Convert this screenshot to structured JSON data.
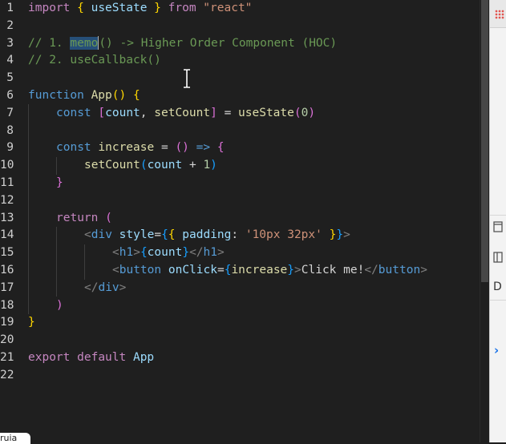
{
  "editor": {
    "line_numbers": [
      "1",
      "2",
      "3",
      "4",
      "5",
      "6",
      "7",
      "8",
      "9",
      "10",
      "11",
      "12",
      "13",
      "14",
      "15",
      "16",
      "17",
      "18",
      "19",
      "20",
      "21",
      "22"
    ],
    "tokens": {
      "l1": {
        "import": "import",
        "lb": "{",
        "useState": "useState",
        "rb": "}",
        "from": "from",
        "str": "\"react\""
      },
      "l3": {
        "c1": "// 1. ",
        "memo": "memo",
        "c2": "() -> Higher Order Component (HOC)"
      },
      "l4": {
        "c": "// 2. useCallback()"
      },
      "l6": {
        "function": "function",
        "name": "App",
        "lp": "(",
        "rp": ")",
        "lb": "{"
      },
      "l7": {
        "const": "const",
        "lb": "[",
        "count": "count",
        "comma": ",",
        "setCount": "setCount",
        "rb": "]",
        "eq": "=",
        "useState": "useState",
        "lp": "(",
        "zero": "0",
        "rp": ")"
      },
      "l9": {
        "const": "const",
        "increase": "increase",
        "eq": "=",
        "lp": "(",
        "rp": ")",
        "arrow": "=>",
        "lb": "{"
      },
      "l10": {
        "setCount": "setCount",
        "lp": "(",
        "count": "count",
        "plus": "+",
        "one": "1",
        "rp": ")"
      },
      "l11": {
        "rb": "}"
      },
      "l13": {
        "return": "return",
        "lp": "("
      },
      "l14": {
        "lt": "<",
        "div": "div",
        "style": "style",
        "eq": "=",
        "lb1": "{",
        "lb2": "{",
        "padding": "padding",
        "colon": ":",
        "val": "'10px 32px'",
        "rb2": "}",
        "rb1": "}",
        "gt": ">"
      },
      "l15": {
        "lt": "<",
        "h1": "h1",
        "gt": ">",
        "lb": "{",
        "count": "count",
        "rb": "}",
        "lt2": "</",
        "h1b": "h1",
        "gt2": ">"
      },
      "l16": {
        "lt": "<",
        "button": "button",
        "onClick": "onClick",
        "eq": "=",
        "lb": "{",
        "increase": "increase",
        "rb": "}",
        "gt": ">",
        "text": "Click me!",
        "lt2": "</",
        "buttonb": "button",
        "gt2": ">"
      },
      "l17": {
        "lt": "</",
        "div": "div",
        "gt": ">"
      },
      "l18": {
        "rp": ")"
      },
      "l19": {
        "rb": "}"
      },
      "l21": {
        "export": "export",
        "default": "default",
        "app": "App"
      }
    }
  },
  "devtools": {
    "label_d": "D",
    "arrow": "›"
  },
  "tooltip": {
    "text": "ruia"
  }
}
